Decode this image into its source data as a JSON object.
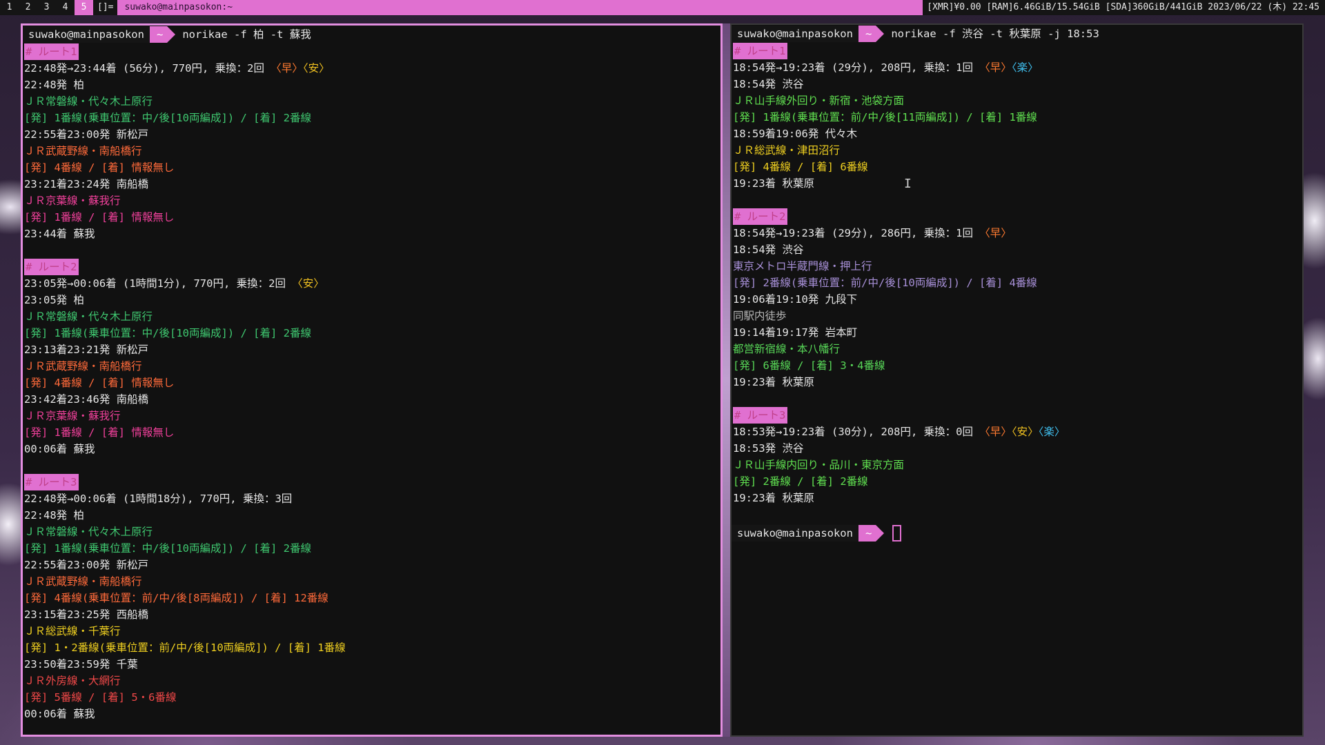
{
  "topbar": {
    "workspaces": [
      "1",
      "2",
      "3",
      "4",
      "5"
    ],
    "active_workspace": "5",
    "layout_symbol": "[]=",
    "window_title": "suwako@mainpasokon:~",
    "status_text": "[XMR]¥0.00 [RAM]6.46GiB/15.54GiB [SDA]360GiB/441GiB 2023/06/22 (木) 22:45"
  },
  "colors": {
    "accent": "#e070d0",
    "terminal_bg": "#111111",
    "jr_joban": "#3fc870",
    "jr_musashino": "#f04848",
    "jr_keiyo": "#f0409a",
    "jr_sobu": "#f0d020",
    "jr_sotobo": "#ff6a3a"
  },
  "left_terminal": {
    "prompt_user": "suwako@mainpasokon",
    "prompt_dir": "~",
    "command": "norikae -f 柏 -t 蘇我",
    "routes": [
      {
        "tag": "# ルート1",
        "summary": "22:48発→23:44着 (56分), 770円, 乗換：2回 ",
        "flags": [
          "〈早〉",
          "〈安〉"
        ],
        "lines": [
          {
            "text": "22:48発 柏",
            "color": "white"
          },
          {
            "text": "ＪＲ常磐線・代々木上原行",
            "color": "green"
          },
          {
            "text": "[発] 1番線(乗車位置：中/後[10両編成]) / [着] 2番線",
            "color": "green"
          },
          {
            "text": "22:55着23:00発 新松戸",
            "color": "white"
          },
          {
            "text": "ＪＲ武蔵野線・南船橋行",
            "color": "orange"
          },
          {
            "text": "[発] 4番線 / [着] 情報無し",
            "color": "orange"
          },
          {
            "text": "23:21着23:24発 南船橋",
            "color": "white"
          },
          {
            "text": "ＪＲ京葉線・蘇我行",
            "color": "pink"
          },
          {
            "text": "[発] 1番線 / [着] 情報無し",
            "color": "pink"
          },
          {
            "text": "23:44着 蘇我",
            "color": "white"
          }
        ]
      },
      {
        "tag": "# ルート2",
        "summary": "23:05発→00:06着 (1時間1分), 770円, 乗換：2回 ",
        "flags": [
          "〈安〉"
        ],
        "lines": [
          {
            "text": "23:05発 柏",
            "color": "white"
          },
          {
            "text": "ＪＲ常磐線・代々木上原行",
            "color": "green"
          },
          {
            "text": "[発] 1番線(乗車位置：中/後[10両編成]) / [着] 2番線",
            "color": "green"
          },
          {
            "text": "23:13着23:21発 新松戸",
            "color": "white"
          },
          {
            "text": "ＪＲ武蔵野線・南船橋行",
            "color": "orange"
          },
          {
            "text": "[発] 4番線 / [着] 情報無し",
            "color": "orange"
          },
          {
            "text": "23:42着23:46発 南船橋",
            "color": "white"
          },
          {
            "text": "ＪＲ京葉線・蘇我行",
            "color": "pink"
          },
          {
            "text": "[発] 1番線 / [着] 情報無し",
            "color": "pink"
          },
          {
            "text": "00:06着 蘇我",
            "color": "white"
          }
        ]
      },
      {
        "tag": "# ルート3",
        "summary": "22:48発→00:06着 (1時間18分), 770円, 乗換：3回",
        "flags": [],
        "lines": [
          {
            "text": "22:48発 柏",
            "color": "white"
          },
          {
            "text": "ＪＲ常磐線・代々木上原行",
            "color": "green"
          },
          {
            "text": "[発] 1番線(乗車位置：中/後[10両編成]) / [着] 2番線",
            "color": "green"
          },
          {
            "text": "22:55着23:00発 新松戸",
            "color": "white"
          },
          {
            "text": "ＪＲ武蔵野線・南船橋行",
            "color": "orange"
          },
          {
            "text": "[発] 4番線(乗車位置：前/中/後[8両編成]) / [着] 12番線",
            "color": "orange"
          },
          {
            "text": "23:15着23:25発 西船橋",
            "color": "white"
          },
          {
            "text": "ＪＲ総武線・千葉行",
            "color": "yellow"
          },
          {
            "text": "[発] 1・2番線(乗車位置：前/中/後[10両編成]) / [着] 1番線",
            "color": "yellow"
          },
          {
            "text": "23:50着23:59発 千葉",
            "color": "white"
          },
          {
            "text": "ＪＲ外房線・大網行",
            "color": "red"
          },
          {
            "text": "[発] 5番線 / [着] 5・6番線",
            "color": "red"
          },
          {
            "text": "00:06着 蘇我",
            "color": "white"
          }
        ]
      }
    ]
  },
  "right_terminal": {
    "prompt_user": "suwako@mainpasokon",
    "prompt_dir": "~",
    "command": "norikae -f 渋谷 -t 秋葉原 -j 18:53",
    "routes": [
      {
        "tag": "# ルート1",
        "summary": "18:54発→19:23着 (29分), 208円, 乗換：1回 ",
        "flags": [
          "〈早〉",
          "〈楽〉"
        ],
        "lines": [
          {
            "text": "18:54発 渋谷",
            "color": "white"
          },
          {
            "text": "ＪＲ山手線外回り・新宿・池袋方面",
            "color": "lime"
          },
          {
            "text": "[発] 1番線(乗車位置：前/中/後[11両編成]) / [着] 1番線",
            "color": "lime"
          },
          {
            "text": "18:59着19:06発 代々木",
            "color": "white"
          },
          {
            "text": "ＪＲ総武線・津田沼行",
            "color": "yellow"
          },
          {
            "text": "[発] 4番線 / [着] 6番線",
            "color": "yellow"
          },
          {
            "text": "19:23着 秋葉原",
            "color": "white"
          }
        ]
      },
      {
        "tag": "# ルート2",
        "summary": "18:54発→19:23着 (29分), 286円, 乗換：1回 ",
        "flags": [
          "〈早〉"
        ],
        "lines": [
          {
            "text": "18:54発 渋谷",
            "color": "white"
          },
          {
            "text": "東京メトロ半蔵門線・押上行",
            "color": "purple"
          },
          {
            "text": "[発] 2番線(乗車位置：前/中/後[10両編成]) / [着] 4番線",
            "color": "purple"
          },
          {
            "text": "19:06着19:10発 九段下",
            "color": "white"
          },
          {
            "text": "同駅内徒歩",
            "color": "gray"
          },
          {
            "text": "19:14着19:17発 岩本町",
            "color": "white"
          },
          {
            "text": "都営新宿線・本八幡行",
            "color": "green2"
          },
          {
            "text": "[発] 6番線 / [着] 3・4番線",
            "color": "green2"
          },
          {
            "text": "19:23着 秋葉原",
            "color": "white"
          }
        ]
      },
      {
        "tag": "# ルート3",
        "summary": "18:53発→19:23着 (30分), 208円, 乗換：0回 ",
        "flags": [
          "〈早〉",
          "〈安〉",
          "〈楽〉"
        ],
        "lines": [
          {
            "text": "18:53発 渋谷",
            "color": "white"
          },
          {
            "text": "ＪＲ山手線内回り・品川・東京方面",
            "color": "lime"
          },
          {
            "text": "[発] 2番線 / [着] 2番線",
            "color": "lime"
          },
          {
            "text": "19:23着 秋葉原",
            "color": "white"
          }
        ]
      }
    ],
    "final_prompt_user": "suwako@mainpasokon",
    "final_prompt_dir": "~"
  }
}
